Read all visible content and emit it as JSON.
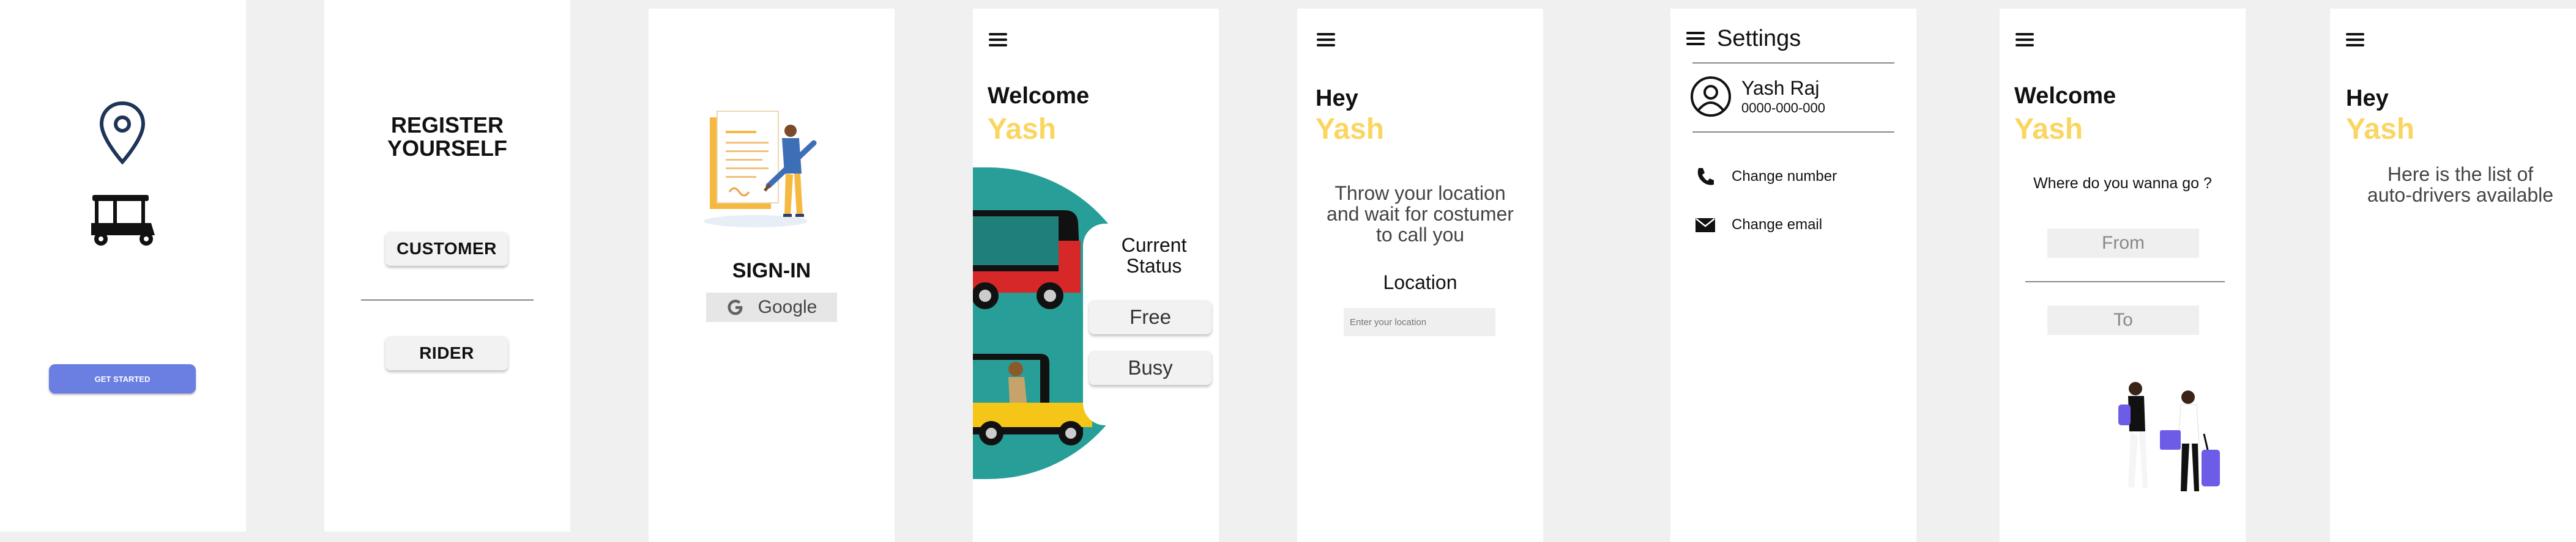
{
  "screen1": {
    "get_started": "GET STARTED"
  },
  "screen2": {
    "title_line1": "REGISTER",
    "title_line2": "YOURSELF",
    "customer": "CUSTOMER",
    "rider": "RIDER"
  },
  "screen3": {
    "title": "SIGN-IN",
    "google": "Google"
  },
  "screen4": {
    "welcome": "Welcome",
    "name": "Yash",
    "status_line1": "Current",
    "status_line2": "Status",
    "free": "Free",
    "busy": "Busy"
  },
  "screen5": {
    "hey": "Hey",
    "name": "Yash",
    "message_line1": "Throw your location",
    "message_line2": "and wait for costumer",
    "message_line3": "to call you",
    "location_label": "Location",
    "location_placeholder": "Enter your location"
  },
  "screen6": {
    "title": "Settings",
    "user_name": "Yash Raj",
    "user_phone": "0000-000-000",
    "change_number": "Change number",
    "change_email": "Change email"
  },
  "screen7": {
    "welcome": "Welcome",
    "name": "Yash",
    "question": "Where do you wanna go ?",
    "from": "From",
    "to": "To"
  },
  "screen8": {
    "hey": "Hey",
    "name": "Yash",
    "message_line1": "Here is the list of",
    "message_line2": "auto-drivers available"
  },
  "colors": {
    "accent_yellow": "#fad660",
    "teal": "#279f98",
    "button_blue": "#6b7fe3",
    "navy": "#1d3557"
  }
}
